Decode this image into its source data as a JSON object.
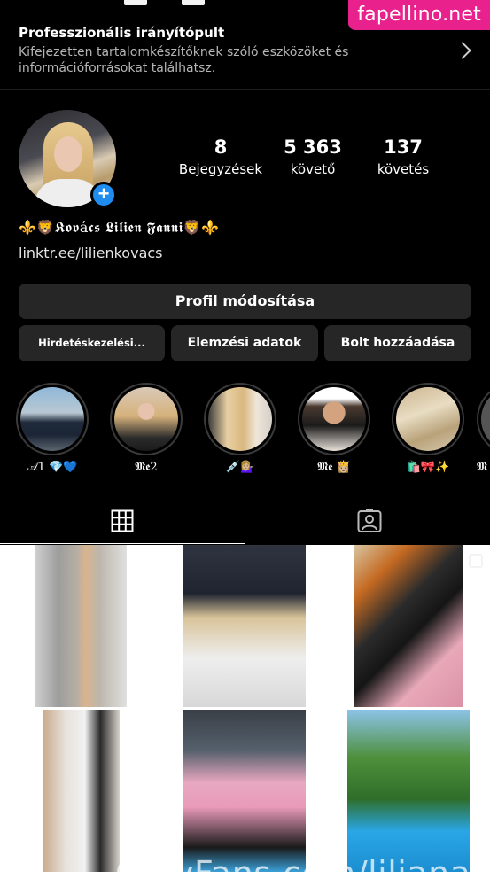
{
  "watermark_top": "fapellino.net",
  "professional_dashboard": {
    "title": "Professzionális irányítópult",
    "description": "Kifejezetten tartalomkészítőknek szóló eszközöket és információforrásokat találhatsz."
  },
  "profile": {
    "stats": [
      {
        "value": "8",
        "label": "Bejegyzések"
      },
      {
        "value": "5 363",
        "label": "követő"
      },
      {
        "value": "137",
        "label": "követés"
      }
    ],
    "display_name": "⚜️🦁𝕶𝖔𝖛á𝖈𝖘 𝕷𝖎𝖑𝖎𝖊𝖓 𝕱𝖆𝖓𝖓𝖎🦁⚜️",
    "link": "linktr.ee/lilienkovacs"
  },
  "buttons": {
    "edit_profile": "Profil módosítása",
    "ads": "Hirdetéskezelési...",
    "insights": "Elemzési adatok",
    "add_shop": "Bolt hozzáadása"
  },
  "highlights": [
    {
      "label": "𝒜1 💎💙"
    },
    {
      "label": "𝕸𝖊2"
    },
    {
      "label": "💉💁🏼‍♀️"
    },
    {
      "label": "𝕸𝖊 👸🏼"
    },
    {
      "label": "🛍️🎀✨"
    },
    {
      "label": "𝕸"
    }
  ],
  "tabs": [
    {
      "icon": "grid-icon",
      "active": true
    },
    {
      "icon": "tagged-person-icon",
      "active": false
    }
  ],
  "posts_count_visible": 6,
  "watermark_bottom": "OnlyFans.com/lilianaah"
}
